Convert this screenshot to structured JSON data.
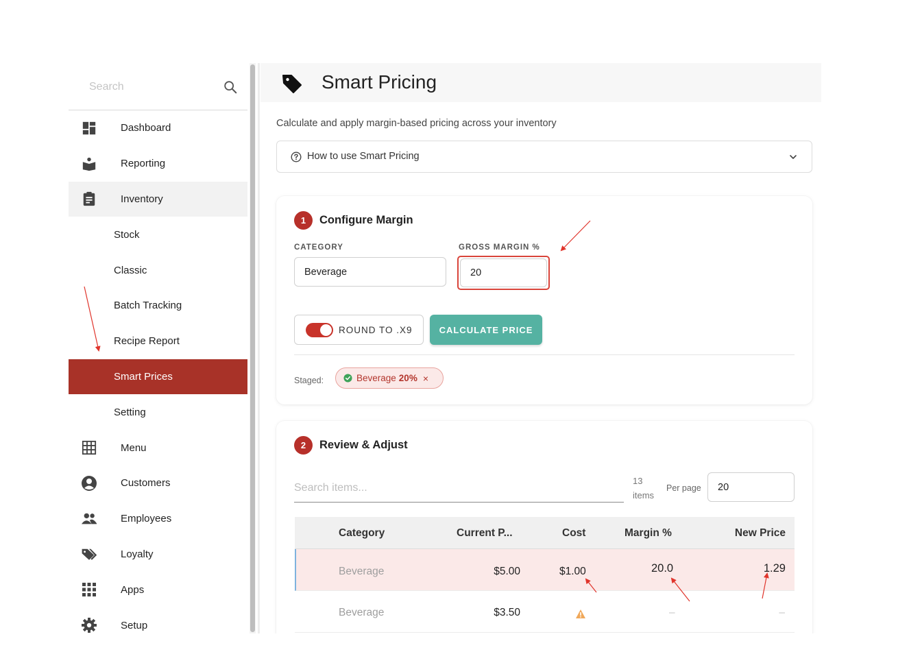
{
  "sidebar": {
    "search_placeholder": "Search",
    "items": [
      {
        "label": "Dashboard",
        "icon": "dashboard-icon"
      },
      {
        "label": "Reporting",
        "icon": "reporting-icon"
      },
      {
        "label": "Inventory",
        "icon": "clipboard-icon"
      },
      {
        "label": "Stock"
      },
      {
        "label": "Classic"
      },
      {
        "label": "Batch Tracking"
      },
      {
        "label": "Recipe Report"
      },
      {
        "label": "Smart Prices"
      },
      {
        "label": "Setting"
      },
      {
        "label": "Menu",
        "icon": "grid-icon"
      },
      {
        "label": "Customers",
        "icon": "account-icon"
      },
      {
        "label": "Employees",
        "icon": "people-icon"
      },
      {
        "label": "Loyalty",
        "icon": "tags-icon"
      },
      {
        "label": "Apps",
        "icon": "apps-icon"
      },
      {
        "label": "Setup",
        "icon": "gear-icon"
      }
    ]
  },
  "header": {
    "title": "Smart Pricing",
    "icon": "tag-icon"
  },
  "subtitle": "Calculate and apply margin-based pricing across your inventory",
  "howto": {
    "label": "How to use Smart Pricing"
  },
  "configure": {
    "step": "1",
    "title": "Configure Margin",
    "category_label": "CATEGORY",
    "category_value": "Beverage",
    "margin_label": "GROSS MARGIN %",
    "margin_value": "20",
    "round_label": "ROUND TO .X9",
    "round_enabled": true,
    "calculate_label": "CALCULATE PRICE",
    "staged_label": "Staged:",
    "staged_category": "Beverage",
    "staged_pct": "20%",
    "staged_remove": "×"
  },
  "review": {
    "step": "2",
    "title": "Review & Adjust",
    "search_placeholder": "Search items...",
    "count_num": "13",
    "count_label": "items",
    "per_page_label": "Per page",
    "per_page_value": "20",
    "columns": [
      "Category",
      "Current P...",
      "Cost",
      "Margin %",
      "New Price"
    ],
    "rows": [
      {
        "category": "Beverage",
        "current": "$5.00",
        "cost": "$1.00",
        "margin": "20.0",
        "new_price": "1.29"
      },
      {
        "category": "Beverage",
        "current": "$3.50",
        "cost": "warning-icon",
        "margin": "–",
        "new_price": "–"
      }
    ]
  },
  "colors": {
    "accent": "#a83228",
    "teal": "#55b2a2",
    "annotation": "#e0342b"
  }
}
